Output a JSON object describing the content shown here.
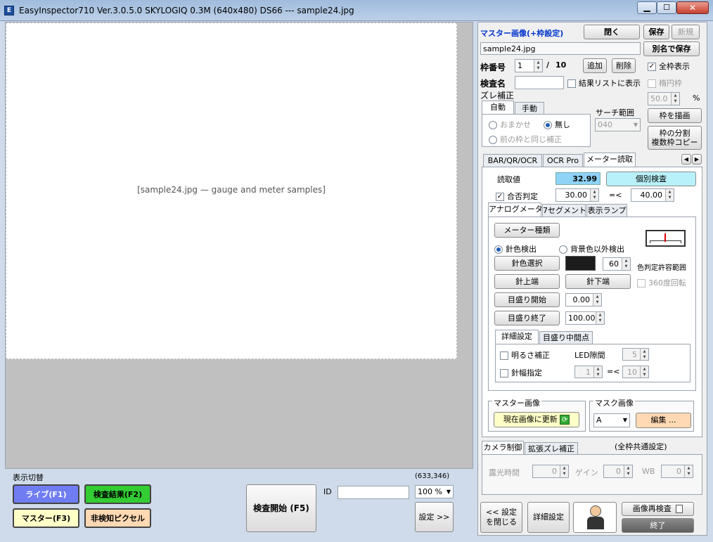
{
  "window": {
    "title": "EasyInspector710 Ver.3.0.5.0 SKYLOGIQ 0.3M   (640x480) DS66 --- sample24.jpg"
  },
  "master": {
    "title": "マスター画像(+枠設定)",
    "filename": "sample24.jpg",
    "close_label": "閉く",
    "save_label": "保存",
    "new_label": "新規",
    "saveas_label": "別名で保存"
  },
  "frame": {
    "label": "枠番号",
    "value": "1",
    "total": "10",
    "add_label": "追加",
    "delete_label": "削除",
    "show_all_label": "全枠表示",
    "name_label": "検査名",
    "name_value": "",
    "result_list_label": "結果リストに表示",
    "ellipse_label": "楕円枠",
    "percent_value": "50.0",
    "percent_unit": "%"
  },
  "offset": {
    "title": "ズレ補正",
    "tab_auto": "自動",
    "tab_manual": "手動",
    "auto_label": "おまかせ",
    "none_label": "無し",
    "same_label": "前の枠と同じ補正",
    "search_label": "サーチ範囲",
    "search_value": "040",
    "draw_label": "枠を描画",
    "copy_label": "枠の分割\n複数枠コピー"
  },
  "tabs": [
    "BAR/QR/OCR",
    "OCR Pro",
    "メーター読取"
  ],
  "meter": {
    "read_label": "読取値",
    "read_value": "32.99",
    "individual_label": "個別検査",
    "judge_label": "合否判定",
    "min_value": "30.00",
    "le_label": "=<",
    "max_value": "40.00",
    "subtabs": [
      "アナログメータ",
      "7セグメント",
      "表示ランプ"
    ],
    "type_label": "メーター種類",
    "needle_color_label": "針色検出",
    "bg_label": "背景色以外検出",
    "color_select_label": "針色選択",
    "tolerance_value": "60",
    "tolerance_label": "色判定許容範囲",
    "needle_top_label": "針上端",
    "needle_bottom_label": "針下端",
    "rotate_label": "360度回転",
    "scale_start_label": "目盛り開始",
    "scale_start_value": "0.00",
    "scale_end_label": "目盛り終了",
    "scale_end_value": "100.00",
    "detail_tab": "詳細設定",
    "mid_tab": "目盛り中間点",
    "brightness_label": "明るさ補正",
    "led_label": "LED隙間",
    "led_value": "5",
    "width_label": "針幅指定",
    "width_min": "1",
    "width_le": "=<",
    "width_max": "10"
  },
  "master_image": {
    "title": "マスター画像",
    "update_label": "現在画像に更新"
  },
  "mask_image": {
    "title": "マスク画像",
    "select_value": "A",
    "edit_label": "編集 ..."
  },
  "camera": {
    "tab_control": "カメラ制御",
    "tab_offset": "拡張ズレ補正",
    "common_label": "(全枠共通設定)",
    "exposure_label": "露光時間",
    "exposure_value": "0",
    "gain_label": "ゲイン",
    "gain_value": "0",
    "wb_label": "WB",
    "wb_value": "0"
  },
  "bottom_right": {
    "close_settings_label": "<< 設定\nを閉じる",
    "detail_settings_label": "詳細設定",
    "reinspect_label": "画像再検査",
    "exit_label": "終了"
  },
  "display_switch": {
    "title": "表示切替",
    "live_label": "ライブ(F1)",
    "result_label": "検査結果(F2)",
    "master_label": "マスター(F3)",
    "undetected_label": "非検知ピクセル"
  },
  "inspect": {
    "start_label": "検査開始 (F5)",
    "id_label": "ID",
    "id_value": ""
  },
  "status": {
    "coords": "(633,346)",
    "zoom": "100 %",
    "settings_label": "設定 >>"
  },
  "image_placeholder": "[sample24.jpg — gauge and meter samples]",
  "colors": {
    "live_btn": "#6f7cf2",
    "result_btn": "#33cc33",
    "master_btn": "#ffffc8",
    "undetected_btn": "#ffd9b3",
    "read_value_bg": "#8fd3f6",
    "individual_bg": "#b9f1fb"
  }
}
